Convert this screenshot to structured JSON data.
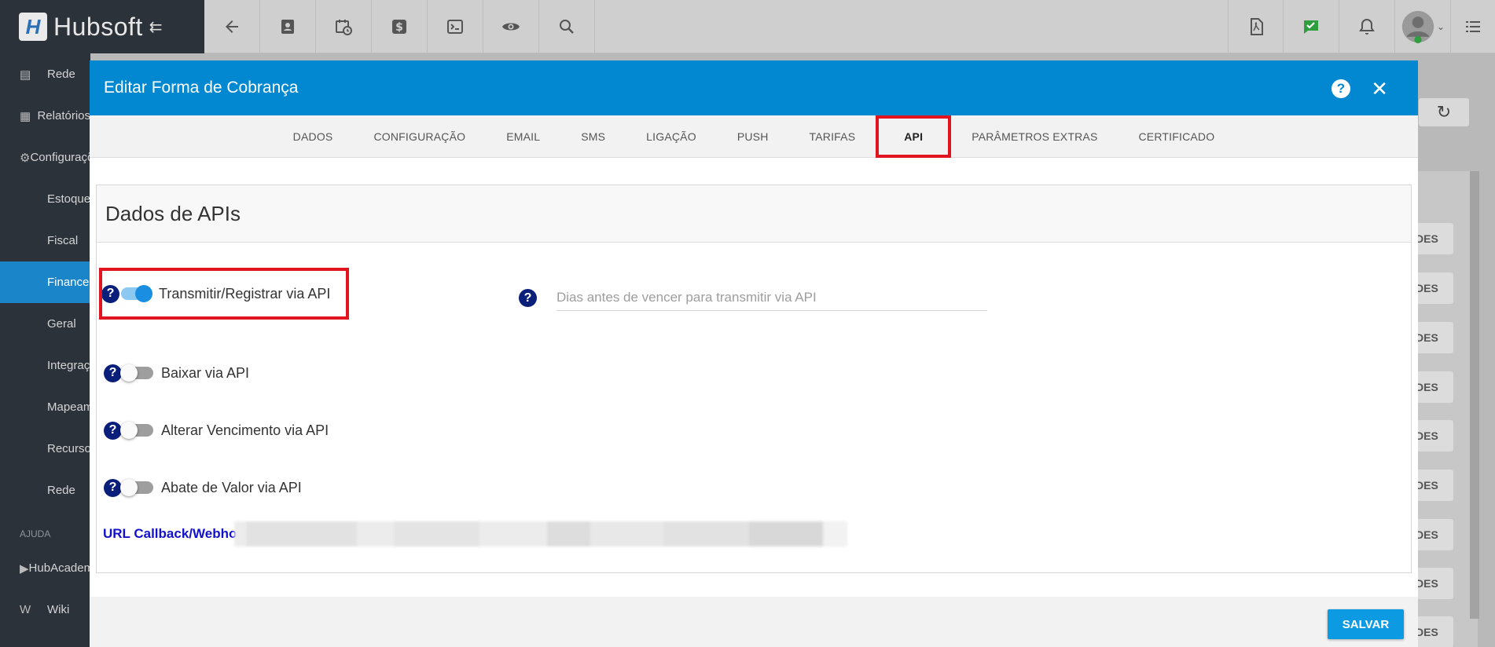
{
  "app": {
    "name": "Hubsoft"
  },
  "sidebar": {
    "items": [
      {
        "label": "Rede",
        "icon": "server-icon"
      },
      {
        "label": "Relatórios",
        "icon": "document-icon"
      },
      {
        "label": "Configurações",
        "icon": "gear-icon"
      },
      {
        "label": "Estoque"
      },
      {
        "label": "Fiscal"
      },
      {
        "label": "Financeiro"
      },
      {
        "label": "Geral"
      },
      {
        "label": "Integrações"
      },
      {
        "label": "Mapeamento"
      },
      {
        "label": "Recursos"
      },
      {
        "label": "Rede"
      }
    ],
    "section_help": "AJUDA",
    "help_items": [
      {
        "label": "HubAcademy",
        "icon": "youtube-icon"
      },
      {
        "label": "Wiki",
        "icon": "wikipedia-icon"
      }
    ]
  },
  "toolbar_icons": [
    "back-arrow-icon",
    "contact-card-icon",
    "calendar-clock-icon",
    "dollar-icon",
    "terminal-icon",
    "eye-icon",
    "search-icon",
    "pdf-icon",
    "check-message-icon",
    "bell-icon",
    "user-avatar-icon",
    "list-menu-icon"
  ],
  "background": {
    "row_button_label": "DES"
  },
  "modal": {
    "title": "Editar Forma de Cobrança",
    "help_symbol": "?",
    "close_symbol": "✕",
    "tabs": [
      "DADOS",
      "CONFIGURAÇÃO",
      "EMAIL",
      "SMS",
      "LIGAÇÃO",
      "PUSH",
      "TARIFAS",
      "API",
      "PARÂMETROS EXTRAS",
      "CERTIFICADO"
    ],
    "active_tab": "API",
    "panel_title": "Dados de APIs",
    "toggles": [
      {
        "label": "Transmitir/Registrar via API",
        "on": true
      },
      {
        "label": "Baixar via API",
        "on": false
      },
      {
        "label": "Alterar Vencimento via API",
        "on": false
      },
      {
        "label": "Abate de Valor via API",
        "on": false
      }
    ],
    "dias_placeholder": "Dias antes de vencer para transmitir via API",
    "url_label": "URL Callback/Webhook:",
    "save_label": "SALVAR"
  },
  "colors": {
    "header": "#0288d1",
    "highlight": "#e0151f",
    "save": "#0c9be3",
    "help_icon": "#0a1f7a",
    "link_label": "#1111cc"
  }
}
